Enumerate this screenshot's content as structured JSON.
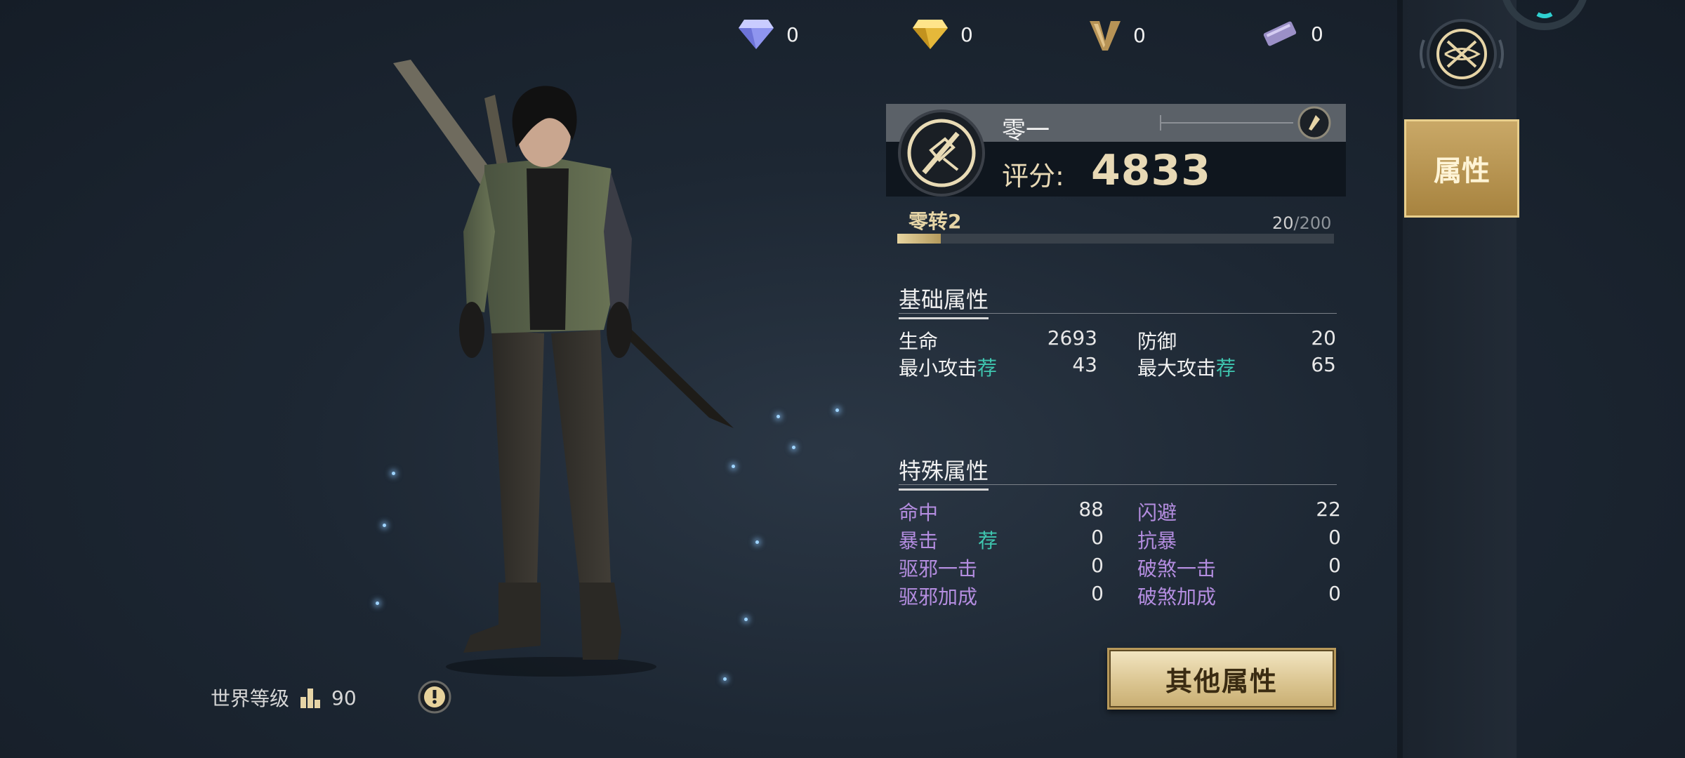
{
  "currencies": [
    {
      "icon": "blue-diamond-icon",
      "value": "0"
    },
    {
      "icon": "gold-diamond-icon",
      "value": "0"
    },
    {
      "icon": "v-emblem-icon",
      "value": "0"
    },
    {
      "icon": "ticket-icon",
      "value": "0"
    }
  ],
  "profile": {
    "name": "零一",
    "score_label": "评分:",
    "score": "4833"
  },
  "progress": {
    "stage": "零转2",
    "current": "20",
    "max": "/200",
    "fraction": 0.1
  },
  "basic": {
    "title": "基础属性",
    "rows": [
      {
        "label": "生命",
        "value": "2693",
        "label2": "防御",
        "value2": "20"
      },
      {
        "label": "最小攻击",
        "rec": "荐",
        "value": "43",
        "label2": "最大攻击",
        "rec2": "荐",
        "value2": "65"
      }
    ]
  },
  "special": {
    "title": "特殊属性",
    "rows": [
      {
        "label": "命中",
        "value": "88",
        "label2": "闪避",
        "value2": "22"
      },
      {
        "label": "暴击",
        "rec": "荐",
        "value": "0",
        "label2": "抗暴",
        "value2": "0"
      },
      {
        "label": "驱邪一击",
        "value": "0",
        "label2": "破煞一击",
        "value2": "0"
      },
      {
        "label": "驱邪加成",
        "value": "0",
        "label2": "破煞加成",
        "value2": "0"
      }
    ]
  },
  "buttons": {
    "other_attributes": "其他属性",
    "attributes_tab": "属性"
  },
  "world": {
    "label": "世界等级",
    "value": "90"
  },
  "colors": {
    "gold": "#e8d9b5",
    "special_stat": "#b48de0",
    "recommend": "#3fc7b0"
  }
}
